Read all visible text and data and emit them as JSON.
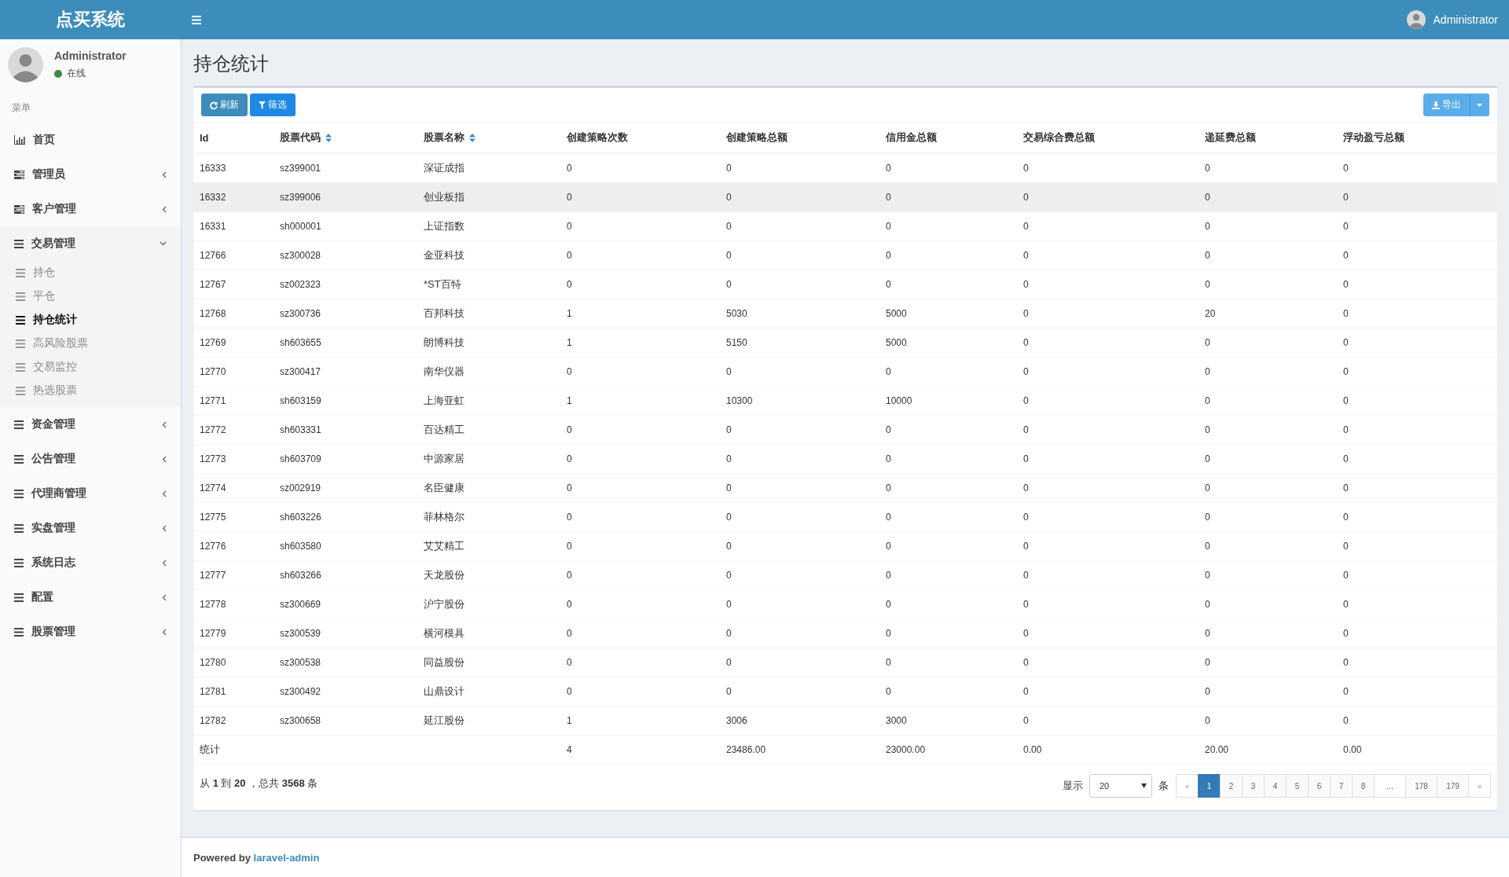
{
  "header": {
    "brand": "点买系统",
    "user": "Administrator"
  },
  "sidebar": {
    "user": {
      "name": "Administrator",
      "status": {
        "label": "在线",
        "color": "#3c8a3c"
      }
    },
    "menu_title": "菜单",
    "items": [
      {
        "label": "首页"
      },
      {
        "label": "管理员",
        "expanded": false
      },
      {
        "label": "客户管理",
        "expanded": false
      },
      {
        "label": "交易管理",
        "expanded": true,
        "children": [
          {
            "label": "持仓",
            "selected": false
          },
          {
            "label": "平仓",
            "selected": false
          },
          {
            "label": "持仓统计",
            "selected": true
          },
          {
            "label": "高风险股票",
            "selected": false
          },
          {
            "label": "交易监控",
            "selected": false
          },
          {
            "label": "热选股票",
            "selected": false
          }
        ]
      },
      {
        "label": "资金管理",
        "expanded": false
      },
      {
        "label": "公告管理",
        "expanded": false
      },
      {
        "label": "代理商管理",
        "expanded": false
      },
      {
        "label": "实盘管理",
        "expanded": false
      },
      {
        "label": "系统日志",
        "expanded": false
      },
      {
        "label": "配置",
        "expanded": false
      },
      {
        "label": "股票管理",
        "expanded": false
      }
    ]
  },
  "page": {
    "title": "持仓统计"
  },
  "toolbar": {
    "refresh": "刷新",
    "filter": "筛选",
    "export": "导出"
  },
  "table": {
    "columns": [
      {
        "label": "Id",
        "sortable": false
      },
      {
        "label": "股票代码",
        "sortable": true
      },
      {
        "label": "股票名称",
        "sortable": true
      },
      {
        "label": "创建策略次数",
        "sortable": false
      },
      {
        "label": "创建策略总额",
        "sortable": false
      },
      {
        "label": "信用金总额",
        "sortable": false
      },
      {
        "label": "交易综合费总额",
        "sortable": false
      },
      {
        "label": "递延费总额",
        "sortable": false
      },
      {
        "label": "浮动盈亏总额",
        "sortable": false
      }
    ],
    "rows": [
      {
        "hovered": false,
        "cells": [
          "16333",
          "sz399001",
          "深证成指",
          "0",
          "0",
          "0",
          "0",
          "0",
          "0"
        ]
      },
      {
        "hovered": true,
        "cells": [
          "16332",
          "sz399006",
          "创业板指",
          "0",
          "0",
          "0",
          "0",
          "0",
          "0"
        ]
      },
      {
        "hovered": false,
        "cells": [
          "16331",
          "sh000001",
          "上证指数",
          "0",
          "0",
          "0",
          "0",
          "0",
          "0"
        ]
      },
      {
        "hovered": false,
        "cells": [
          "12766",
          "sz300028",
          "金亚科技",
          "0",
          "0",
          "0",
          "0",
          "0",
          "0"
        ]
      },
      {
        "hovered": false,
        "cells": [
          "12767",
          "sz002323",
          "*ST百特",
          "0",
          "0",
          "0",
          "0",
          "0",
          "0"
        ]
      },
      {
        "hovered": false,
        "cells": [
          "12768",
          "sz300736",
          "百邦科技",
          "1",
          "5030",
          "5000",
          "0",
          "20",
          "0"
        ]
      },
      {
        "hovered": false,
        "cells": [
          "12769",
          "sh603655",
          "朗博科技",
          "1",
          "5150",
          "5000",
          "0",
          "0",
          "0"
        ]
      },
      {
        "hovered": false,
        "cells": [
          "12770",
          "sz300417",
          "南华仪器",
          "0",
          "0",
          "0",
          "0",
          "0",
          "0"
        ]
      },
      {
        "hovered": false,
        "cells": [
          "12771",
          "sh603159",
          "上海亚虹",
          "1",
          "10300",
          "10000",
          "0",
          "0",
          "0"
        ]
      },
      {
        "hovered": false,
        "cells": [
          "12772",
          "sh603331",
          "百达精工",
          "0",
          "0",
          "0",
          "0",
          "0",
          "0"
        ]
      },
      {
        "hovered": false,
        "cells": [
          "12773",
          "sh603709",
          "中源家居",
          "0",
          "0",
          "0",
          "0",
          "0",
          "0"
        ]
      },
      {
        "hovered": false,
        "cells": [
          "12774",
          "sz002919",
          "名臣健康",
          "0",
          "0",
          "0",
          "0",
          "0",
          "0"
        ]
      },
      {
        "hovered": false,
        "cells": [
          "12775",
          "sh603226",
          "菲林格尔",
          "0",
          "0",
          "0",
          "0",
          "0",
          "0"
        ]
      },
      {
        "hovered": false,
        "cells": [
          "12776",
          "sh603580",
          "艾艾精工",
          "0",
          "0",
          "0",
          "0",
          "0",
          "0"
        ]
      },
      {
        "hovered": false,
        "cells": [
          "12777",
          "sh603266",
          "天龙股份",
          "0",
          "0",
          "0",
          "0",
          "0",
          "0"
        ]
      },
      {
        "hovered": false,
        "cells": [
          "12778",
          "sz300669",
          "沪宁股份",
          "0",
          "0",
          "0",
          "0",
          "0",
          "0"
        ]
      },
      {
        "hovered": false,
        "cells": [
          "12779",
          "sz300539",
          "横河模具",
          "0",
          "0",
          "0",
          "0",
          "0",
          "0"
        ]
      },
      {
        "hovered": false,
        "cells": [
          "12780",
          "sz300538",
          "同益股份",
          "0",
          "0",
          "0",
          "0",
          "0",
          "0"
        ]
      },
      {
        "hovered": false,
        "cells": [
          "12781",
          "sz300492",
          "山鼎设计",
          "0",
          "0",
          "0",
          "0",
          "0",
          "0"
        ]
      },
      {
        "hovered": false,
        "cells": [
          "12782",
          "sz300658",
          "延江股份",
          "1",
          "3006",
          "3000",
          "0",
          "0",
          "0"
        ]
      }
    ],
    "summary": {
      "label": "统计",
      "cells": [
        "4",
        "23486.00",
        "23000.00",
        "0.00",
        "20.00",
        "0.00"
      ]
    }
  },
  "pagination": {
    "info": "从 **1** 到 **20** ，总共 **3568** 条",
    "show_label": "显示",
    "per_page": "20",
    "unit": "条",
    "pages": [
      {
        "label": "«",
        "kind": "arrow",
        "selected": false
      },
      {
        "label": "1",
        "kind": "page",
        "selected": true
      },
      {
        "label": "2",
        "kind": "page",
        "selected": false
      },
      {
        "label": "3",
        "kind": "page",
        "selected": false
      },
      {
        "label": "4",
        "kind": "page",
        "selected": false
      },
      {
        "label": "5",
        "kind": "page",
        "selected": false
      },
      {
        "label": "6",
        "kind": "page",
        "selected": false
      },
      {
        "label": "7",
        "kind": "page",
        "selected": false
      },
      {
        "label": "8",
        "kind": "page",
        "selected": false
      },
      {
        "label": "...",
        "kind": "ellipsis",
        "selected": false
      },
      {
        "label": "178",
        "kind": "page",
        "selected": false
      },
      {
        "label": "179",
        "kind": "page",
        "selected": false
      },
      {
        "label": "»",
        "kind": "arrow",
        "selected": false
      }
    ]
  },
  "footer": {
    "prefix": "Powered by",
    "link": "laravel-admin"
  }
}
